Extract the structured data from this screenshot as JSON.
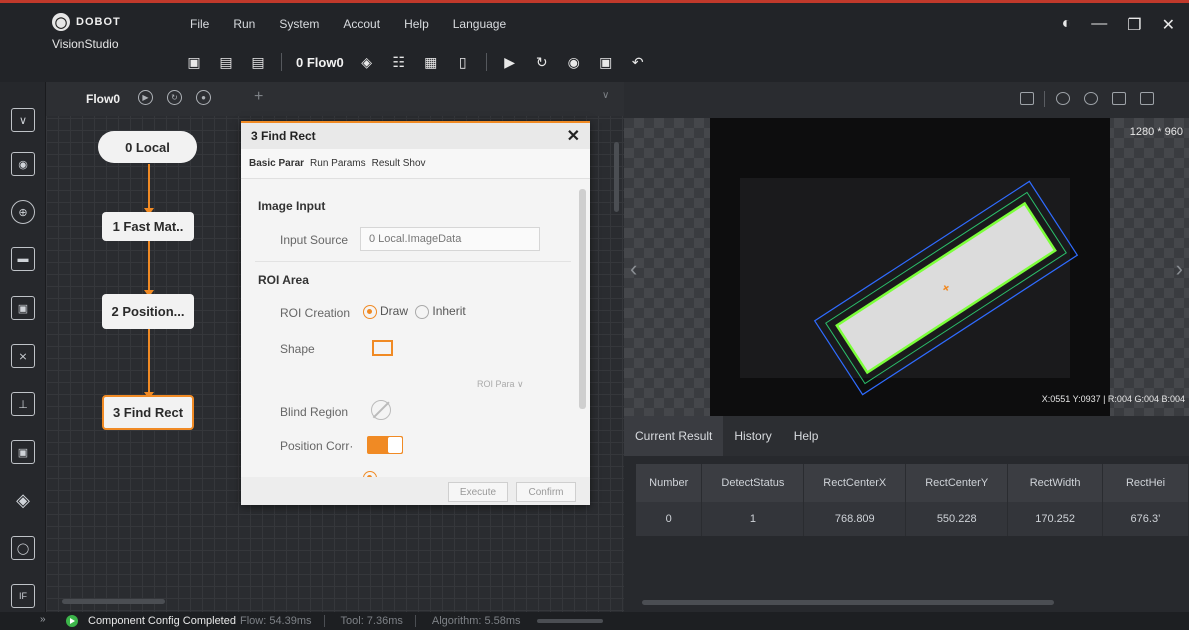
{
  "app": {
    "brand": "DOBOT",
    "product": "VisionStudio",
    "menu": [
      "File",
      "Run",
      "System",
      "Accout",
      "Help",
      "Language"
    ]
  },
  "toolbar": {
    "flow_selector": "0 Flow0",
    "icons": [
      "add-flow-icon",
      "save-icon",
      "open-folder-icon",
      "layers-icon",
      "network-icon",
      "variable-icon",
      "device-icon",
      "run-once-icon",
      "run-loop-icon",
      "stop-icon",
      "form-icon",
      "undo-icon"
    ]
  },
  "flow": {
    "tab_label": "Flow0",
    "nodes": [
      "0 Local",
      "1 Fast Mat..",
      "2 Position...",
      "3 Find Rect"
    ]
  },
  "dialog": {
    "title": "3 Find Rect",
    "tabs": [
      "Basic Parar",
      "Run Params",
      "Result Shov"
    ],
    "image_input_header": "Image Input",
    "input_source_label": "Input Source",
    "input_source_value": "0 Local.ImageData",
    "roi_header": "ROI Area",
    "roi_creation_label": "ROI Creation",
    "roi_draw": "Draw",
    "roi_inherit": "Inherit",
    "shape_label": "Shape",
    "roi_para": "ROI Para ∨",
    "blind_region_label": "Blind Region",
    "position_corr_label": "Position Corr·",
    "execute": "Execute",
    "confirm": "Confirm"
  },
  "viewer": {
    "dimensions": "1280 * 960",
    "readout": "X:0551 Y:0937 | R:004 G:004 B:004"
  },
  "results": {
    "tabs": [
      "Current Result",
      "History",
      "Help"
    ],
    "columns": [
      "Number",
      "DetectStatus",
      "RectCenterX",
      "RectCenterY",
      "RectWidth",
      "RectHei"
    ],
    "rows": [
      [
        "0",
        "1",
        "768.809",
        "550.228",
        "170.252",
        "676.3’"
      ]
    ]
  },
  "status": {
    "message": "Component Config Completed",
    "flow": "Flow: 54.39ms",
    "tool": "Tool: 7.36ms",
    "algorithm": "Algorithm: 5.58ms"
  },
  "colors": {
    "accent": "#f08a24",
    "detect_green": "#7cff3a",
    "roi_blue": "#2f6bff"
  }
}
